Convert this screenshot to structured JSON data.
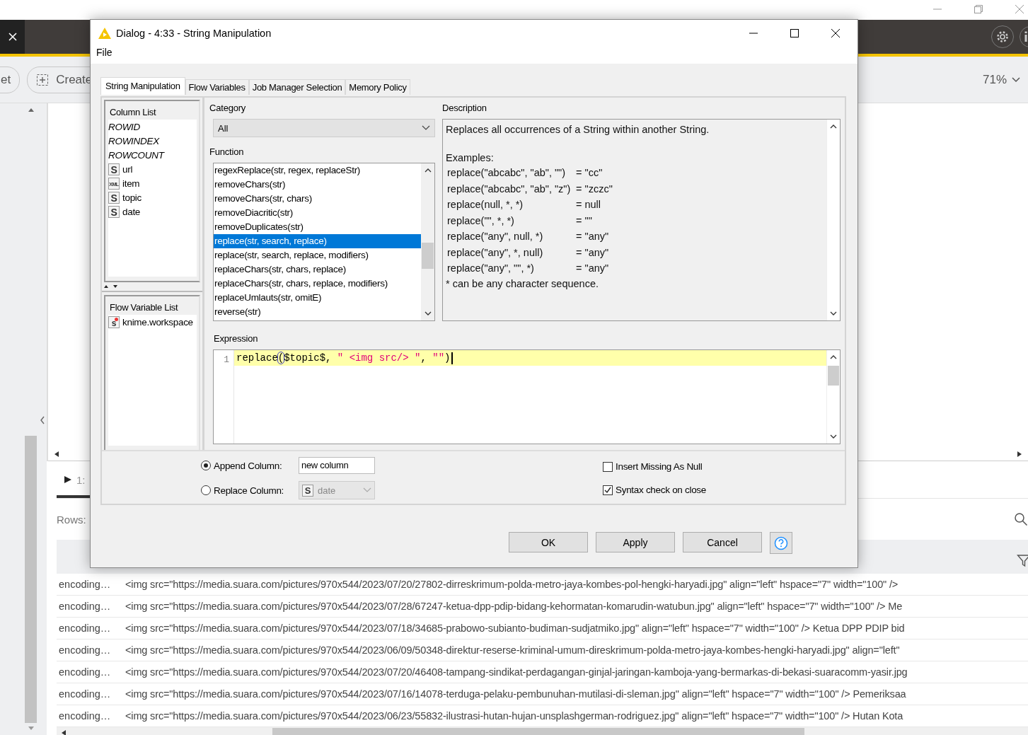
{
  "toolbar": {
    "buttons": [
      {
        "label": "et",
        "kind": "plain"
      },
      {
        "label": "Create",
        "kind": "create"
      }
    ],
    "zoom": "71%"
  },
  "bottom_panel": {
    "tab": "1:",
    "rows_label": "Rows:",
    "rows": [
      {
        "column_1": "encoding…",
        "column_2": "<img src=\"https://media.suara.com/pictures/970x544/2023/07/20/27802-dirreskrimum-polda-metro-jaya-kombes-pol-hengki-haryadi.jpg\" align=\"left\" hspace=\"7\" width=\"100\" />"
      },
      {
        "column_1": "encoding…",
        "column_2": "<img src=\"https://media.suara.com/pictures/970x544/2023/07/28/67247-ketua-dpp-pdip-bidang-kehormatan-komarudin-watubun.jpg\" align=\"left\" hspace=\"7\" width=\"100\" /> Me"
      },
      {
        "column_1": "encoding…",
        "column_2": "<img src=\"https://media.suara.com/pictures/970x544/2023/07/18/34685-prabowo-subianto-budiman-sudjatmiko.jpg\" align=\"left\" hspace=\"7\" width=\"100\" /> Ketua DPP PDIP bid"
      },
      {
        "column_1": "encoding…",
        "column_2": "<img src=\"https://media.suara.com/pictures/970x544/2023/06/09/50348-direktur-reserse-kriminal-umum-direskrimum-polda-metro-jaya-kombes-hengki-haryadi.jpg\" align=\"left\""
      },
      {
        "column_1": "encoding…",
        "column_2": "<img src=\"https://media.suara.com/pictures/970x544/2023/07/20/46408-tampang-sindikat-perdagangan-ginjal-jaringan-kamboja-yang-bermarkas-di-bekasi-suaracomm-yasir.jpg"
      },
      {
        "column_1": "encoding…",
        "column_2": "<img src=\"https://media.suara.com/pictures/970x544/2023/07/16/14078-terduga-pelaku-pembunuhan-mutilasi-di-sleman.jpg\" align=\"left\" hspace=\"7\" width=\"100\" /> Pemeriksaa"
      },
      {
        "column_1": "encoding…",
        "column_2": "<img src=\"https://media.suara.com/pictures/970x544/2023/06/23/55832-ilustrasi-hutan-hujan-unsplashgerman-rodriguez.jpg\" align=\"left\" hspace=\"7\" width=\"100\" /> Hutan Kota"
      }
    ]
  },
  "dialog": {
    "title": "Dialog - 4:33 - String Manipulation",
    "menu": [
      "File"
    ],
    "tabs": [
      {
        "label": "String Manipulation",
        "selected": true
      },
      {
        "label": "Flow Variables",
        "selected": false
      },
      {
        "label": "Job Manager Selection",
        "selected": false
      },
      {
        "label": "Memory Policy",
        "selected": false
      }
    ],
    "column_list": {
      "title": "Column List",
      "items": [
        {
          "name": "ROWID",
          "kind": "special"
        },
        {
          "name": "ROWINDEX",
          "kind": "special"
        },
        {
          "name": "ROWCOUNT",
          "kind": "special"
        },
        {
          "name": "url",
          "kind": "string",
          "badge": "S"
        },
        {
          "name": "item",
          "kind": "xml",
          "badge": "XML"
        },
        {
          "name": "topic",
          "kind": "string",
          "badge": "S"
        },
        {
          "name": "date",
          "kind": "string",
          "badge": "S"
        }
      ]
    },
    "flow_variable_list": {
      "title": "Flow Variable List",
      "items": [
        {
          "name": "knime.workspace",
          "badge": "s"
        }
      ]
    },
    "category": {
      "label": "Category",
      "value": "All"
    },
    "function": {
      "label": "Function",
      "items": [
        {
          "text": "regexReplace(str, regex, replaceStr)",
          "selected": false
        },
        {
          "text": "removeChars(str)",
          "selected": false
        },
        {
          "text": "removeChars(str, chars)",
          "selected": false
        },
        {
          "text": "removeDiacritic(str)",
          "selected": false
        },
        {
          "text": "removeDuplicates(str)",
          "selected": false
        },
        {
          "text": "replace(str, search, replace)",
          "selected": true
        },
        {
          "text": "replace(str, search, replace, modifiers)",
          "selected": false
        },
        {
          "text": "replaceChars(str, chars, replace)",
          "selected": false
        },
        {
          "text": "replaceChars(str, chars, replace, modifiers)",
          "selected": false
        },
        {
          "text": "replaceUmlauts(str, omitE)",
          "selected": false
        },
        {
          "text": "reverse(str)",
          "selected": false
        }
      ]
    },
    "description": {
      "label": "Description",
      "summary": "Replaces all occurrences of a String within another String.",
      "examples_label": "Examples:",
      "examples": [
        {
          "call": "replace(\"abcabc\", \"ab\", \"\")",
          "result": "= \"cc\""
        },
        {
          "call": "replace(\"abcabc\", \"ab\", \"z\")",
          "result": "= \"zczc\""
        },
        {
          "call": "replace(null, *, *)",
          "result": "= null"
        },
        {
          "call": "replace(\"\", *, *)",
          "result": "= \"\""
        },
        {
          "call": "replace(\"any\", null, *)",
          "result": "= \"any\""
        },
        {
          "call": "replace(\"any\", *, null)",
          "result": "= \"any\""
        },
        {
          "call": "replace(\"any\", \"\", *)",
          "result": "= \"any\""
        }
      ],
      "note": "* can be any character sequence."
    },
    "expression": {
      "label": "Expression",
      "line_number": "1",
      "tokens": [
        {
          "text": "replace",
          "kind": "code"
        },
        {
          "text": "(",
          "kind": "bracket"
        },
        {
          "text": "$topic$, ",
          "kind": "code"
        },
        {
          "text": "\" <img src/> \"",
          "kind": "string"
        },
        {
          "text": ", ",
          "kind": "code"
        },
        {
          "text": "\"\"",
          "kind": "string"
        },
        {
          "text": ")",
          "kind": "code"
        }
      ]
    },
    "output": [
      {
        "label": "Append Column:",
        "selected": true,
        "kind": "text",
        "value": "new column"
      },
      {
        "label": "Replace Column:",
        "selected": false,
        "kind": "column",
        "badge": "S",
        "value": "date"
      }
    ],
    "options": [
      {
        "label": "Insert Missing As Null",
        "checked": false
      },
      {
        "label": "Syntax check on close",
        "checked": true
      }
    ],
    "buttons": [
      "OK",
      "Apply",
      "Cancel"
    ]
  }
}
